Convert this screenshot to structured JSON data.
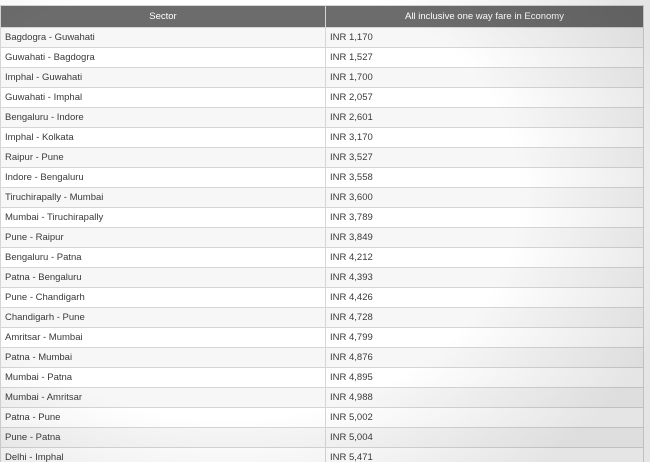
{
  "table": {
    "headers": [
      "Sector",
      "All inclusive one way fare in Economy"
    ],
    "rows": [
      [
        "Bagdogra - Guwahati",
        "INR 1,170"
      ],
      [
        "Guwahati - Bagdogra",
        "INR 1,527"
      ],
      [
        "Imphal - Guwahati",
        "INR 1,700"
      ],
      [
        "Guwahati - Imphal",
        "INR 2,057"
      ],
      [
        "Bengaluru - Indore",
        "INR 2,601"
      ],
      [
        "Imphal - Kolkata",
        "INR 3,170"
      ],
      [
        "Raipur - Pune",
        "INR 3,527"
      ],
      [
        "Indore - Bengaluru",
        "INR 3,558"
      ],
      [
        "Tiruchirapally - Mumbai",
        "INR 3,600"
      ],
      [
        "Mumbai - Tiruchirapally",
        "INR 3,789"
      ],
      [
        "Pune - Raipur",
        "INR 3,849"
      ],
      [
        "Bengaluru - Patna",
        "INR 4,212"
      ],
      [
        "Patna - Bengaluru",
        "INR 4,393"
      ],
      [
        "Pune - Chandigarh",
        "INR 4,426"
      ],
      [
        "Chandigarh - Pune",
        "INR 4,728"
      ],
      [
        "Amritsar - Mumbai",
        "INR 4,799"
      ],
      [
        "Patna - Mumbai",
        "INR 4,876"
      ],
      [
        "Mumbai - Patna",
        "INR 4,895"
      ],
      [
        "Mumbai - Amritsar",
        "INR 4,988"
      ],
      [
        "Patna - Pune",
        "INR 5,002"
      ],
      [
        "Pune - Patna",
        "INR 5,004"
      ],
      [
        "Delhi - Imphal",
        "INR 5,471"
      ]
    ]
  }
}
